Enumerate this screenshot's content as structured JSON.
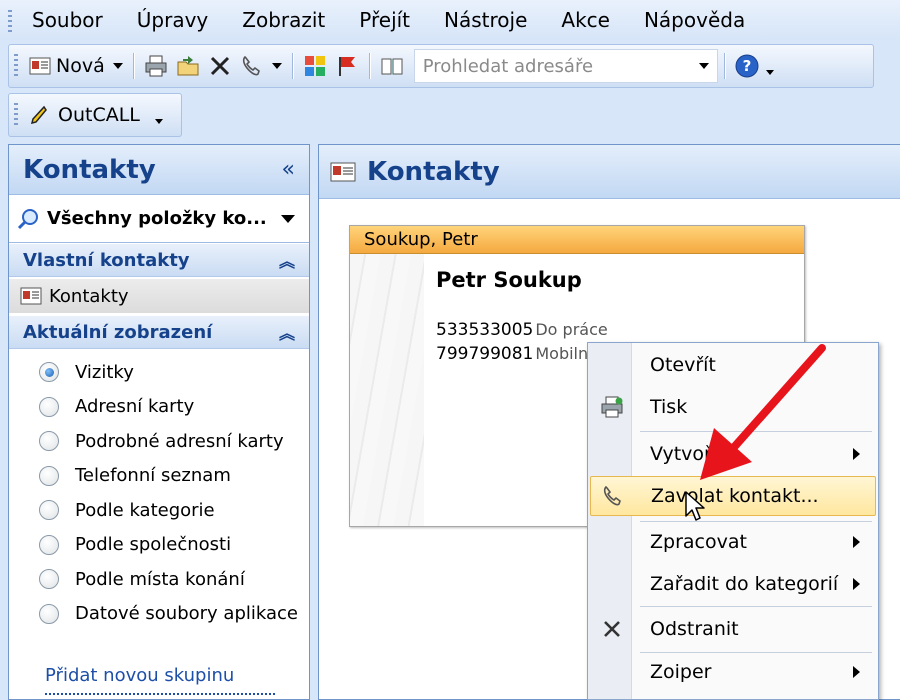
{
  "menu": [
    "Soubor",
    "Úpravy",
    "Zobrazit",
    "Přejít",
    "Nástroje",
    "Akce",
    "Nápověda"
  ],
  "toolbar": {
    "new_label": "Nová",
    "search_placeholder": "Prohledat adresáře"
  },
  "toolbar2": {
    "outcall_label": "OutCALL"
  },
  "nav": {
    "title": "Kontakty",
    "collapse_glyph": "«",
    "view_selector": "Všechny položky ko...",
    "section1": "Vlastní kontakty",
    "contacts_item": "Kontakty",
    "section2": "Aktuální zobrazení",
    "views": [
      "Vizitky",
      "Adresní karty",
      "Podrobné adresní karty",
      "Telefonní seznam",
      "Podle kategorie",
      "Podle společnosti",
      "Podle místa konání",
      "Datové soubory aplikace"
    ],
    "selected_view": "Vizitky",
    "add_group": "Přidat novou skupinu"
  },
  "main": {
    "title": "Kontakty",
    "card": {
      "header": "Soukup, Petr",
      "name": "Petr Soukup",
      "phones": [
        {
          "number": "533533005",
          "label": "Do práce"
        },
        {
          "number": "799799081",
          "label": "Mobiln"
        }
      ]
    }
  },
  "context_menu": [
    {
      "label": "Otevřít",
      "icon": "",
      "submenu": false
    },
    {
      "label": "Tisk",
      "icon": "printer-icon",
      "submenu": false
    },
    {
      "label": "Vytvořit",
      "icon": "",
      "submenu": true
    },
    {
      "label": "Zavolat kontakt...",
      "icon": "phone-icon",
      "submenu": false,
      "highlighted": true
    },
    {
      "label": "Zpracovat",
      "icon": "",
      "submenu": true
    },
    {
      "label": "Zařadit do kategorií",
      "icon": "",
      "submenu": true
    },
    {
      "label": "Odstranit",
      "icon": "delete-x-icon",
      "submenu": false
    },
    {
      "label": "Zoiper",
      "icon": "",
      "submenu": true
    }
  ],
  "colors": {
    "accent_title": "#15428b",
    "card_header": "#f5a940",
    "highlight": "#ffe79f",
    "annotation_arrow": "#e8141c"
  }
}
